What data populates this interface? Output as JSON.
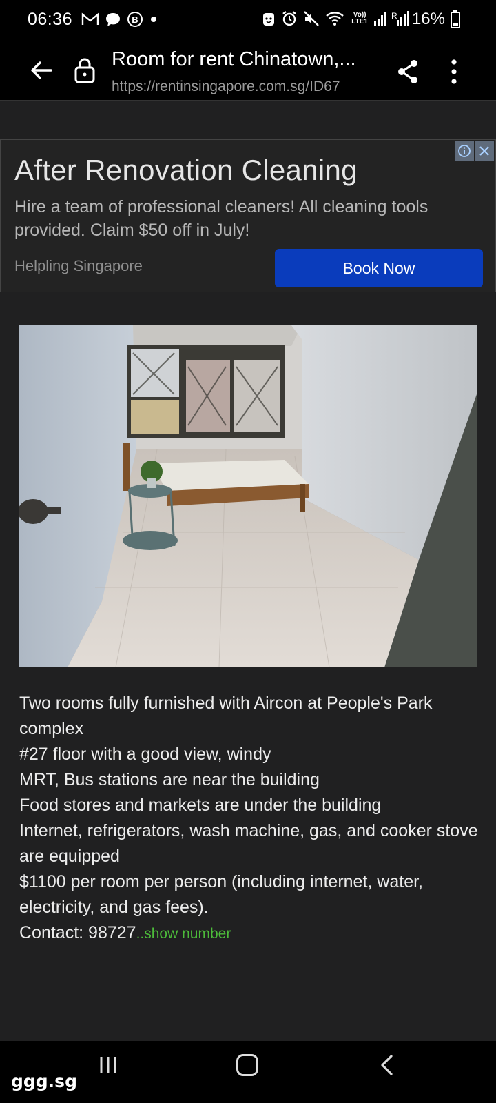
{
  "status_bar": {
    "time": "06:36",
    "battery": "16%",
    "notification_icons": [
      "gmail-icon",
      "chat-icon",
      "b-icon",
      "dot-icon"
    ],
    "system_icons": [
      "face-icon",
      "alarm-icon",
      "mute-icon",
      "wifi-icon",
      "volte-icon",
      "signal-icon"
    ],
    "volte_top": "Vo))",
    "volte_bottom": "LTE1",
    "signal_r": "R"
  },
  "browser": {
    "title": "Room for rent Chinatown,...",
    "url": "https://rentinsingapore.com.sg/ID67"
  },
  "ad": {
    "headline": "After Renovation Cleaning",
    "description": "Hire a team of professional cleaners! All cleaning tools provided. Claim $50 off in July!",
    "advertiser": "Helpling Singapore",
    "cta": "Book Now",
    "cta_color": "#0a3cbc"
  },
  "listing": {
    "lines": [
      "Two rooms fully furnished with Aircon at People's Park complex",
      "#27 floor with a good view, windy",
      "MRT, Bus stations are near the building",
      "Food stores and markets are under the building",
      "Internet, refrigerators, wash machine, gas, and cooker stove are equipped",
      "$1100 per room per person (including internet, water, electricity, and gas fees)."
    ],
    "contact_prefix": "Contact: 98727",
    "show_number": "..show number",
    "show_number_color": "#4cbb3a"
  },
  "watermark": "ggg.sg"
}
